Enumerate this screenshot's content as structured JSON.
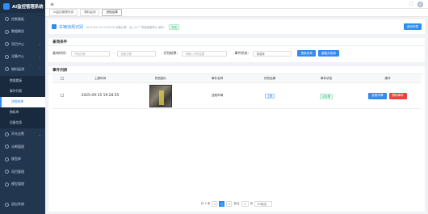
{
  "app": {
    "title": "AI监控管理系统"
  },
  "sidebar": {
    "items": [
      {
        "label": "控制看板"
      },
      {
        "label": "数据概览"
      },
      {
        "label": "项目中心"
      },
      {
        "label": "设备中心"
      },
      {
        "label": "物料监测"
      }
    ],
    "subitems": [
      {
        "label": "数据看板"
      },
      {
        "label": "事件列表"
      },
      {
        "label": "违规结果"
      },
      {
        "label": "物料库"
      },
      {
        "label": "设备信息"
      }
    ],
    "items2": [
      {
        "label": "声光告警"
      },
      {
        "label": "诊断管理"
      },
      {
        "label": "模型库"
      },
      {
        "label": "项目管理"
      },
      {
        "label": "模型管理"
      }
    ],
    "bottom": {
      "label": "退出系统"
    }
  },
  "tabs": [
    {
      "label": "AI监控管理系统"
    },
    {
      "label": "物料监测"
    },
    {
      "label": "违规结果"
    }
  ],
  "info": {
    "title": "车辆违规识别",
    "detail": "2025-09-15 19:28:55  设备位置：出入口  广场通道摄像头  编号：",
    "status": "在线",
    "action": "返回列表"
  },
  "query": {
    "header": "查询条件",
    "time_label": "查询时间：",
    "start_placeholder": "开始日期",
    "end_placeholder": "结束日期",
    "plate_label": "识别结果：",
    "plate_placeholder": "请输入识别结果",
    "status_label": "事件状态：",
    "status_value": "请选择",
    "search": "搜索查询",
    "reset": "重置并查询"
  },
  "list": {
    "header": "事件列表",
    "columns": [
      "",
      "上报时间",
      "抓拍图片",
      "事件名称",
      "识别结果",
      "事件状态",
      "操作"
    ],
    "rows": [
      {
        "time": "2025-09-15 19:28:55",
        "name": "违规车辆",
        "result": "上报",
        "status": "已处理",
        "view": "查看详情",
        "delete": "删除事件"
      }
    ]
  },
  "pager": {
    "total": "共 1 条",
    "prev": "<",
    "current": "1",
    "next": ">",
    "goto": "前往",
    "page_input": "1",
    "page_unit": "页",
    "size": "10条/页"
  },
  "colors": {
    "accent": "#2f8cf0",
    "sidebar": "#22364f",
    "success": "#19be6b",
    "danger": "#ed4040"
  }
}
